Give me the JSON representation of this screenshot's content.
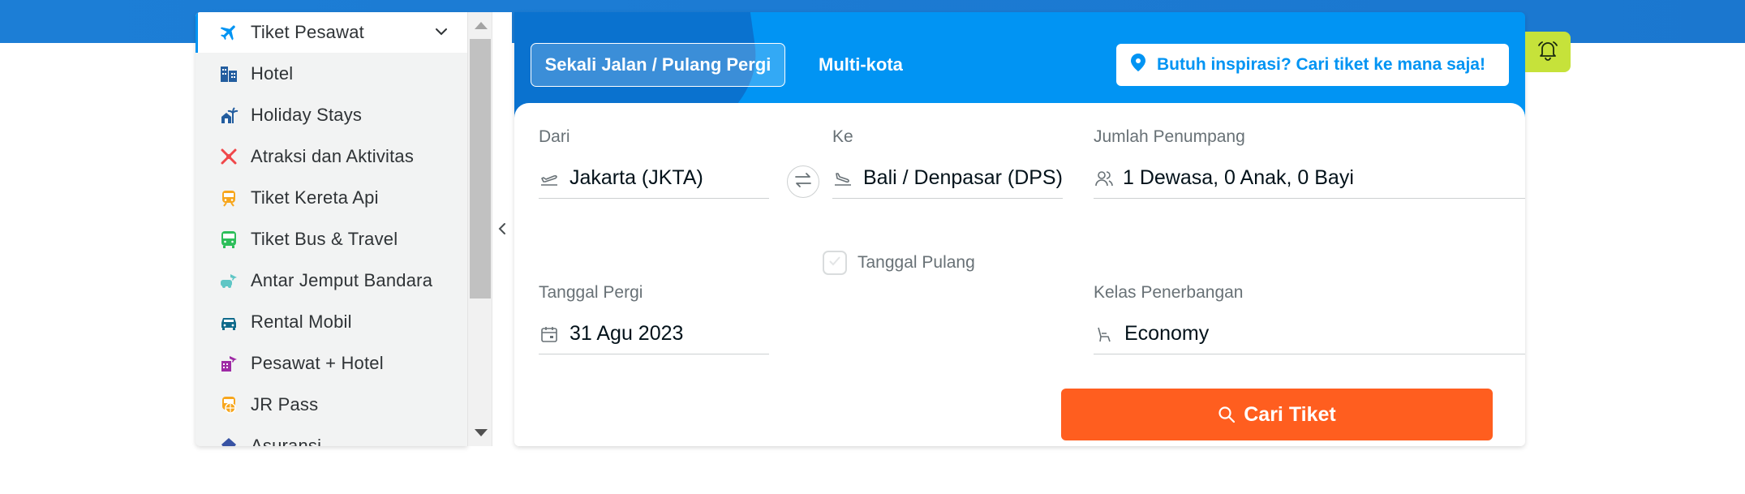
{
  "sidebar": {
    "items": [
      {
        "label": "Tiket Pesawat",
        "icon": "airplane-icon",
        "color": "#0194f3",
        "active": true
      },
      {
        "label": "Hotel",
        "icon": "hotel-building-icon",
        "color": "#235d9f"
      },
      {
        "label": "Holiday Stays",
        "icon": "holiday-stays-icon",
        "color": "#235d9f"
      },
      {
        "label": "Atraksi dan Aktivitas",
        "icon": "attractions-icon",
        "color": "#f0474a"
      },
      {
        "label": "Tiket Kereta Api",
        "icon": "train-icon",
        "color": "#f7a61d"
      },
      {
        "label": "Tiket Bus & Travel",
        "icon": "bus-icon",
        "color": "#2dbe5a"
      },
      {
        "label": "Antar Jemput Bandara",
        "icon": "airport-transfer-icon",
        "color": "#5fc6c5"
      },
      {
        "label": "Rental Mobil",
        "icon": "car-icon",
        "color": "#0f6a8b"
      },
      {
        "label": "Pesawat + Hotel",
        "icon": "flight-hotel-icon",
        "color": "#9e2aa5"
      },
      {
        "label": "JR Pass",
        "icon": "jr-pass-icon",
        "color": "#f7a61d"
      },
      {
        "label": "Asuransi",
        "icon": "insurance-icon",
        "color": "#3853a4"
      }
    ]
  },
  "tabs": {
    "oneway_label": "Sekali Jalan / Pulang Pergi",
    "multicity_label": "Multi-kota"
  },
  "inspiration": {
    "label": "Butuh inspirasi? Cari tiket ke mana saja!"
  },
  "form": {
    "from_label": "Dari",
    "from_value": "Jakarta (JKTA)",
    "to_label": "Ke",
    "to_value": "Bali / Denpasar (DPS)",
    "passengers_label": "Jumlah Penumpang",
    "passengers_value": "1 Dewasa, 0 Anak, 0 Bayi",
    "return_label": "Tanggal Pulang",
    "return_checked": false,
    "depart_label": "Tanggal Pergi",
    "depart_value": "31 Agu 2023",
    "class_label": "Kelas Penerbangan",
    "class_value": "Economy",
    "search_label": "Cari Tiket"
  },
  "colors": {
    "brand_blue": "#0194f3",
    "header_dark": "#0a72cf",
    "search_orange": "#ff5e1f",
    "bell_green": "#c6e23a"
  }
}
